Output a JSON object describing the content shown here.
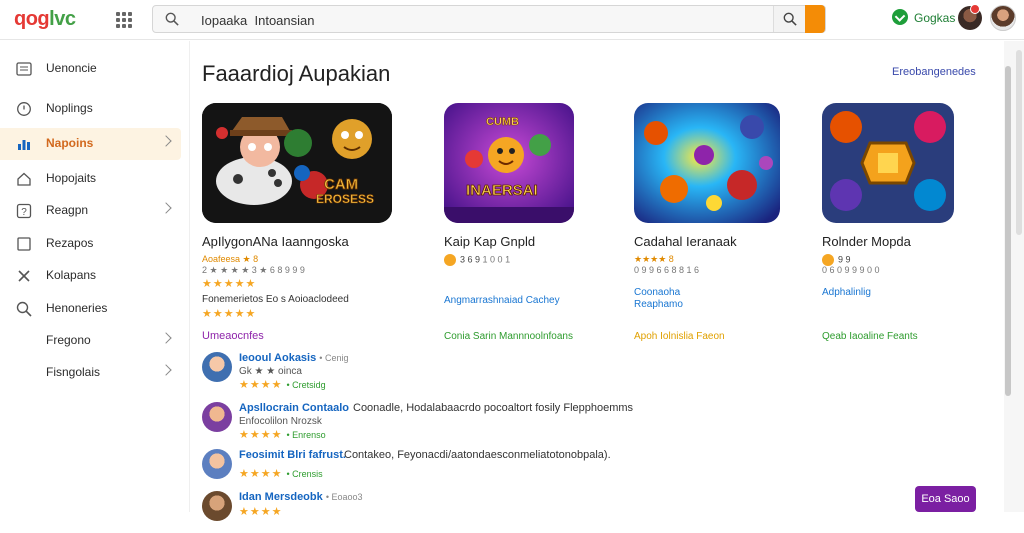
{
  "header": {
    "logo_left": "qog",
    "logo_right": "lvc",
    "search_value": "Iopaaka  Intoansian",
    "user_label": "Gogkas"
  },
  "sidebar": {
    "items": [
      {
        "label": "Uenoncie",
        "icon": "menu-icon",
        "chevron": false,
        "active": false
      },
      {
        "label": "Noplings",
        "icon": "clock-icon",
        "chevron": false,
        "active": false
      },
      {
        "label": "Napoins",
        "icon": "chart-icon",
        "chevron": true,
        "active": true
      },
      {
        "label": "Hopojaits",
        "icon": "home-icon",
        "chevron": false,
        "active": false
      },
      {
        "label": "Reagpn",
        "icon": "question-icon",
        "chevron": true,
        "active": false
      },
      {
        "label": "Rezapos",
        "icon": "square-icon",
        "chevron": false,
        "active": false
      },
      {
        "label": "Kolapans",
        "icon": "tools-icon",
        "chevron": false,
        "active": false
      },
      {
        "label": "Henoneries",
        "icon": "search-icon",
        "chevron": false,
        "active": false
      },
      {
        "label": "Fregono",
        "icon": "none",
        "chevron": true,
        "active": false
      },
      {
        "label": "Fisngolais",
        "icon": "none",
        "chevron": true,
        "active": false
      }
    ]
  },
  "main": {
    "title": "Faaardioj Aupakian",
    "see_more": "Ereobangenedes",
    "apps": [
      {
        "name": "ApIlygonANa Iaanngoska",
        "rating_text": "Aoafeesa ★ 8",
        "meta": "2 ★ ★ ★ ★ 3 ★ 6 8 9 9 9",
        "stars_a": "★★★★★",
        "meta2": "Fonemerietos Eo s Aoioaclodeed",
        "stars_b": "★★★★★",
        "link_primary": "",
        "link_secondary": ""
      },
      {
        "name": "Kaip Kap Gnpld",
        "rating_text": "3 6 9",
        "meta": "1 0 0 1",
        "stars_a": "",
        "meta2": "",
        "stars_b": "",
        "link_primary": "Angmarrashnaiad Cachey",
        "link_secondary": "Conia Sarin Mannnoolnfoans"
      },
      {
        "name": "Cadahal Ieranaak",
        "rating_text": "★★★★ 8",
        "meta": "0 9 9 6 6 8 8 1 6",
        "stars_a": "",
        "meta2": "",
        "stars_b": "",
        "link_primary": "Coonaoha",
        "link_primary_2": "Reaphamo",
        "link_secondary": "Apoh  Iolnislia Faeon"
      },
      {
        "name": "Rolnder  Mopda",
        "rating_text": "9 9",
        "meta": "0 6 0 9 9 9 0 0",
        "stars_a": "",
        "meta2": "",
        "stars_b": "",
        "link_primary": "Adphalinlig",
        "link_secondary": "Qeab  Iaoaline Feants"
      }
    ],
    "section_label": "Umeaocnfes",
    "reviews": [
      {
        "name": "Ieooul Aokasis",
        "tail": "• Cenig",
        "sub": "Gk  ★  ★ oinca",
        "stars": "★★★★",
        "tag": "• Cretsidg",
        "text": ""
      },
      {
        "name": "Apsllocrain Contaalo",
        "tail": "",
        "sub": "Enfocolilon  Nrozsk",
        "stars": "★★★★",
        "tag": "• Enrenso",
        "text": "Coonadle, Hodalabaacrdo pocoaltort fosily Flepphoemms"
      },
      {
        "name": "Feosimit Blri fafrust.",
        "tail": "",
        "sub": "",
        "stars": "★★★★",
        "tag": "• Crensis",
        "text": "Contakeo, Feyonacdi/aatondaesconmeliatotonobpala)."
      },
      {
        "name": "Idan  Mersdeobk",
        "tail": "• Eoaoo3",
        "sub": "",
        "stars": "★★★★",
        "tag": "",
        "text": ""
      }
    ],
    "fab_label": "Eoa Saoo"
  }
}
